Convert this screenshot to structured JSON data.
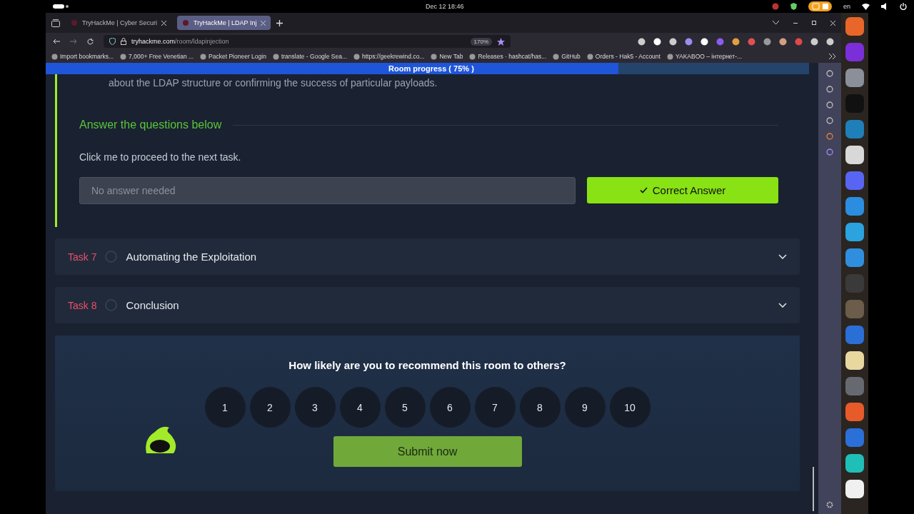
{
  "system_bar": {
    "datetime": "Dec 12  18:46",
    "language": "en"
  },
  "tabs": [
    {
      "title": "TryHackMe | Cyber Securi",
      "selected": false
    },
    {
      "title": "TryHackMe | LDAP Inj",
      "selected": true
    }
  ],
  "address_bar": {
    "host": "tryhackme.com",
    "path": "/room/ldapinjection",
    "zoom": "170%"
  },
  "bookmarks": [
    "Import bookmarks...",
    "7,000+ Free Venetian ...",
    "Packet Pioneer Login",
    "translate - Google Sea...",
    "https://geekrewind.co...",
    "New Tab",
    "Releases · hashcat/has...",
    "GitHub",
    "Orders - Hak5 - Account",
    "YAKABOO – інтернет-..."
  ],
  "room_progress": {
    "label": "Room progress ( 75% )",
    "level": 0.75
  },
  "task_text": "about the LDAP structure or confirming the success of particular payloads.",
  "answer_section": {
    "heading": "Answer the questions below",
    "question": "Click me to proceed to the next task.",
    "placeholder": "No answer needed",
    "button": "Correct Answer"
  },
  "tasks": [
    {
      "label": "Task 7",
      "title": "Automating the Exploitation",
      "completed": false
    },
    {
      "label": "Task 8",
      "title": "Conclusion",
      "completed": false
    }
  ],
  "rating": {
    "question": "How likely are you to recommend this room to others?",
    "options": [
      {
        "label": "1",
        "selected": false
      },
      {
        "label": "2",
        "selected": false
      },
      {
        "label": "3",
        "selected": false
      },
      {
        "label": "4",
        "selected": false
      },
      {
        "label": "5",
        "selected": false
      },
      {
        "label": "6",
        "selected": false
      },
      {
        "label": "7",
        "selected": false
      },
      {
        "label": "8",
        "selected": false
      },
      {
        "label": "9",
        "selected": false
      },
      {
        "label": "10",
        "selected": false
      }
    ],
    "submit": "Submit now"
  }
}
